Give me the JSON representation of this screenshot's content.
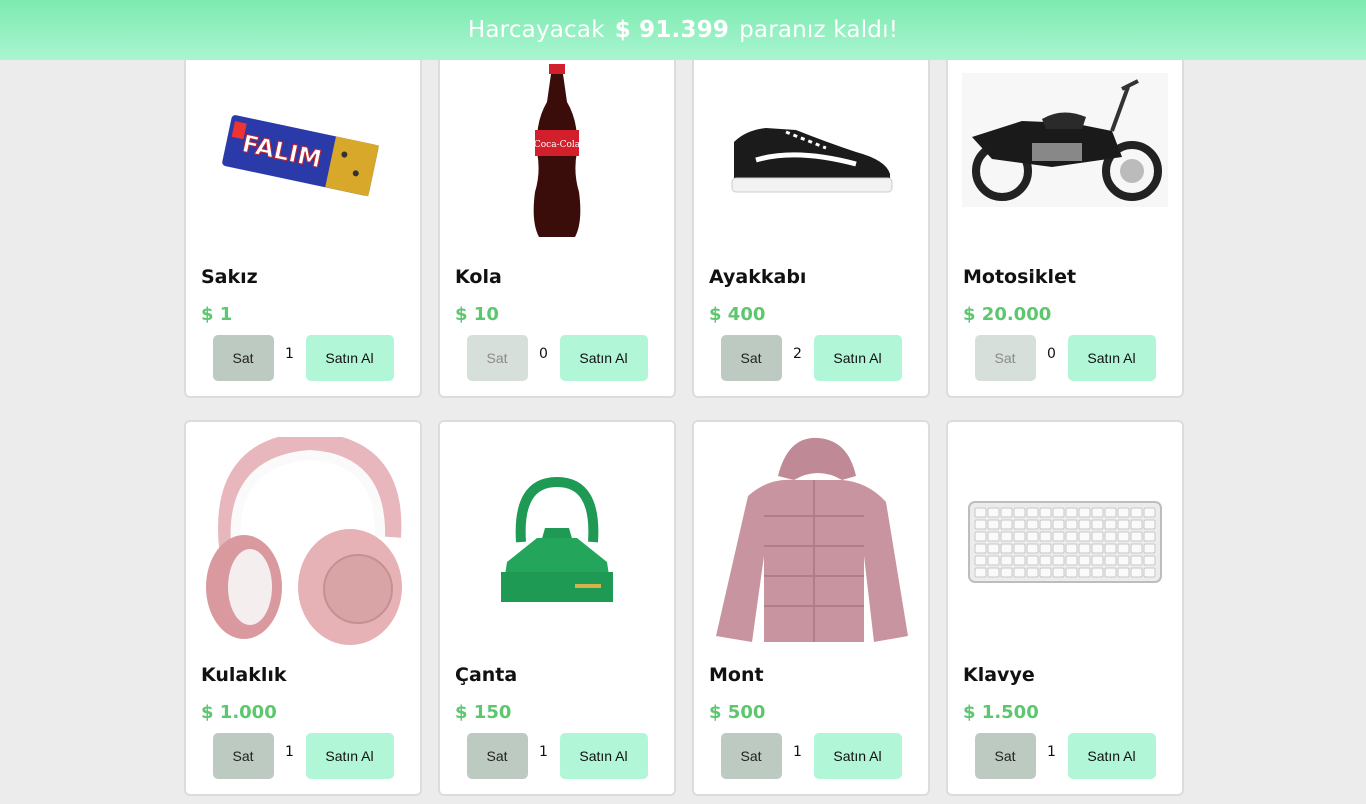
{
  "banner": {
    "prefix": "Harcayacak",
    "amount": "$ 91.399",
    "suffix": "paranız kaldı!"
  },
  "buttons": {
    "sell": "Sat",
    "buy": "Satın Al"
  },
  "products": [
    {
      "name": "Sakız",
      "price": "$ 1",
      "count": "1",
      "sell_enabled": true,
      "image": "gum-pack"
    },
    {
      "name": "Kola",
      "price": "$ 10",
      "count": "0",
      "sell_enabled": false,
      "image": "cola-bottle"
    },
    {
      "name": "Ayakkabı",
      "price": "$ 400",
      "count": "2",
      "sell_enabled": true,
      "image": "sneaker"
    },
    {
      "name": "Motosiklet",
      "price": "$ 20.000",
      "count": "0",
      "sell_enabled": false,
      "image": "motorcycle"
    },
    {
      "name": "Kulaklık",
      "price": "$ 1.000",
      "count": "1",
      "sell_enabled": true,
      "image": "headphones"
    },
    {
      "name": "Çanta",
      "price": "$ 150",
      "count": "1",
      "sell_enabled": true,
      "image": "handbag"
    },
    {
      "name": "Mont",
      "price": "$ 500",
      "count": "1",
      "sell_enabled": true,
      "image": "puffer-jacket"
    },
    {
      "name": "Klavye",
      "price": "$ 1.500",
      "count": "1",
      "sell_enabled": true,
      "image": "keyboard"
    }
  ]
}
